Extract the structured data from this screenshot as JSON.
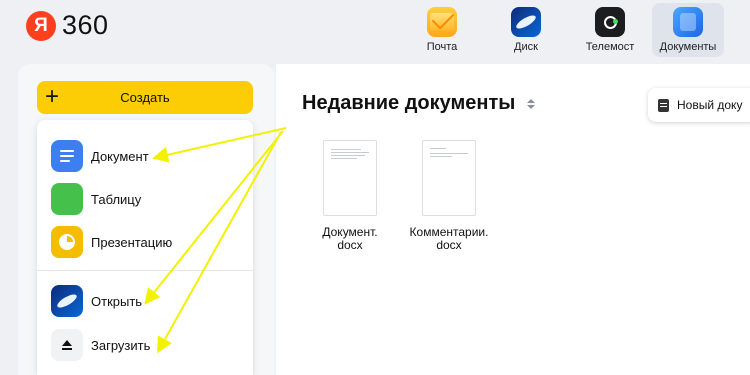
{
  "header": {
    "logo_letter": "Я",
    "logo_text": "360",
    "apps": [
      {
        "label": "Почта",
        "icon": "mail-icon"
      },
      {
        "label": "Диск",
        "icon": "disk-icon"
      },
      {
        "label": "Телемост",
        "icon": "telemost-icon"
      },
      {
        "label": "Документы",
        "icon": "documents-icon",
        "active": true
      }
    ]
  },
  "sidebar": {
    "create_label": "Создать",
    "create_icon": "plus-icon",
    "menu": [
      {
        "label": "Документ",
        "icon": "document-icon"
      },
      {
        "label": "Таблицу",
        "icon": "table-icon"
      },
      {
        "label": "Презентацию",
        "icon": "presentation-icon"
      },
      {
        "label": "Открыть",
        "icon": "disk-open-icon"
      },
      {
        "label": "Загрузить",
        "icon": "upload-icon"
      }
    ]
  },
  "main": {
    "title": "Недавние документы",
    "sort_icon": "sort-icon",
    "new_doc_label": "Новый доку",
    "files": [
      {
        "name_line1": "Документ.",
        "name_line2": "docx"
      },
      {
        "name_line1": "Комментарии.",
        "name_line2": "docx"
      }
    ]
  },
  "colors": {
    "accent_yellow": "#fccd04",
    "brand_red": "#fc3f1d",
    "annotation_arrow": "#f2f200",
    "background": "#eef0f4"
  }
}
